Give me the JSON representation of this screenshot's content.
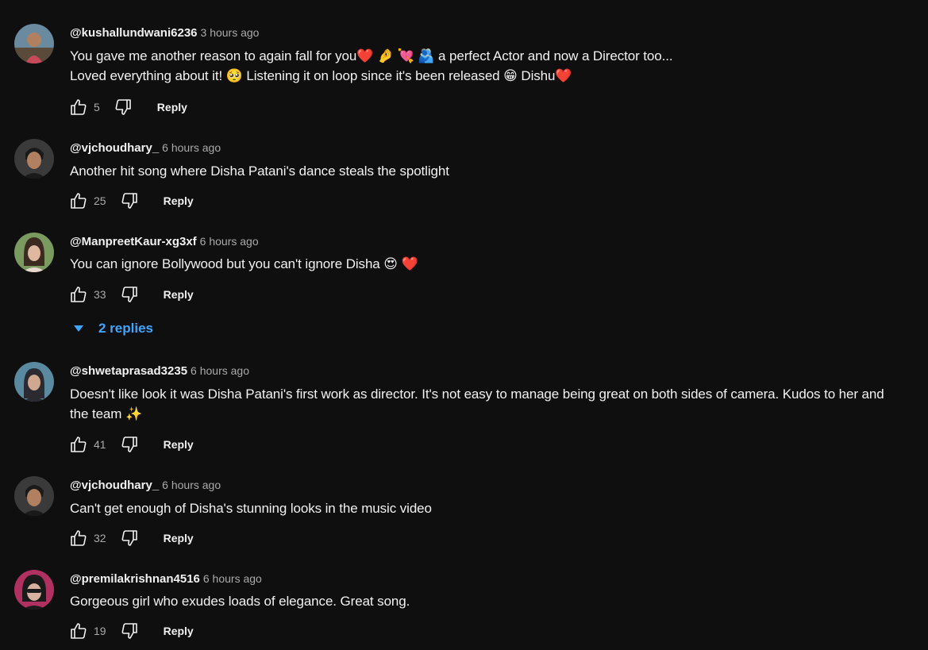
{
  "comments": [
    {
      "author": "@kushallundwani6236",
      "time": "3 hours ago",
      "lines": [
        "You gave me another reason to again fall for you❤️ 🤌 💘 🫂 a perfect Actor and now a Director too...",
        "Loved everything about it! 🥺 Listening it on loop since it's been released 😁 Dishu❤️"
      ],
      "likes": "5",
      "reply_label": "Reply",
      "avatar_colors": [
        "#5a4a3a",
        "#c84a5a",
        "#8ab0c8"
      ]
    },
    {
      "author": "@vjchoudhary_",
      "time": "6 hours ago",
      "lines": [
        "Another hit song where Disha Patani's dance steals the spotlight"
      ],
      "likes": "25",
      "reply_label": "Reply",
      "avatar_colors": [
        "#2a2a2a",
        "#b08060",
        "#1a1a1a"
      ]
    },
    {
      "author": "@ManpreetKaur-xg3xf",
      "time": "6 hours ago",
      "lines": [
        "You can ignore Bollywood but you can't ignore Disha 😍 ❤️"
      ],
      "likes": "33",
      "reply_label": "Reply",
      "replies_label": "2 replies",
      "avatar_colors": [
        "#7a9a60",
        "#e0b8a0",
        "#3a2a20"
      ]
    },
    {
      "author": "@shwetaprasad3235",
      "time": "6 hours ago",
      "lines": [
        "Doesn't like look it was Disha Patani's first work as director. It's not easy to manage being great on both sides of camera. Kudos to her and",
        "the team ✨"
      ],
      "likes": "41",
      "reply_label": "Reply",
      "avatar_colors": [
        "#5a8aa0",
        "#d0a890",
        "#2a2a30"
      ]
    },
    {
      "author": "@vjchoudhary_",
      "time": "6 hours ago",
      "lines": [
        "Can't get enough of Disha's stunning looks in the music video"
      ],
      "likes": "32",
      "reply_label": "Reply",
      "avatar_colors": [
        "#2a2a2a",
        "#b08060",
        "#1a1a1a"
      ]
    },
    {
      "author": "@premilakrishnan4516",
      "time": "6 hours ago",
      "lines": [
        "Gorgeous girl who exudes loads of elegance. Great song."
      ],
      "likes": "19",
      "reply_label": "Reply",
      "avatar_colors": [
        "#b03060",
        "#d8b0a0",
        "#1a1a1a"
      ]
    }
  ],
  "theme": {
    "background": "#0f0f0f",
    "text": "#f1f1f1",
    "secondary": "#aaaaaa",
    "link": "#3ea6ff"
  }
}
